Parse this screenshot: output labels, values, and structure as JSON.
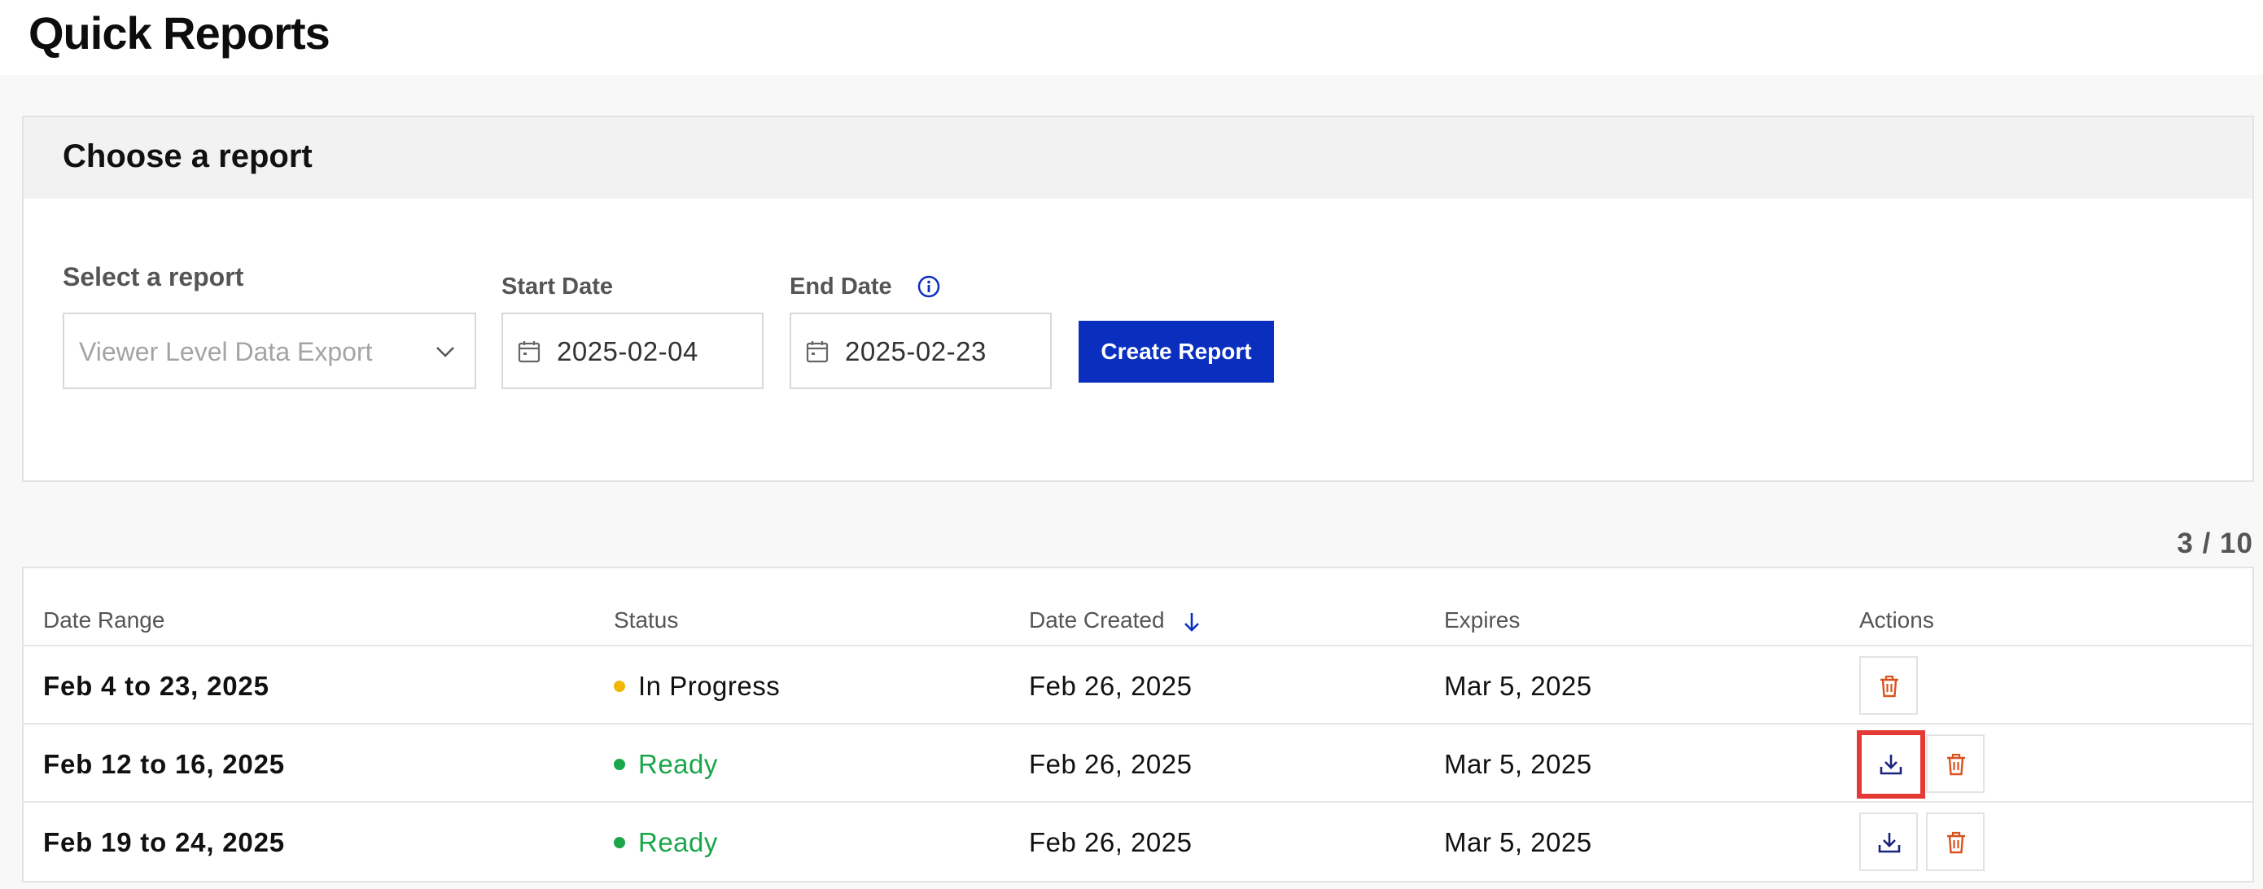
{
  "page": {
    "title": "Quick Reports"
  },
  "panel": {
    "title": "Choose a report",
    "select_label": "Select a report",
    "select_value": "Viewer Level Data Export",
    "start_label": "Start Date",
    "start_value": "2025-02-04",
    "end_label": "End Date",
    "end_value": "2025-02-23",
    "create_button": "Create Report"
  },
  "count": "3 / 10",
  "table": {
    "headers": {
      "date_range": "Date Range",
      "status": "Status",
      "date_created": "Date Created",
      "expires": "Expires",
      "actions": "Actions"
    },
    "rows": [
      {
        "range": "Feb 4 to 23, 2025",
        "status": "In Progress",
        "created": "Feb 26, 2025",
        "expires": "Mar 5, 2025",
        "actions": [
          "delete"
        ]
      },
      {
        "range": "Feb 12 to 16, 2025",
        "status": "Ready",
        "created": "Feb 26, 2025",
        "expires": "Mar 5, 2025",
        "actions": [
          "download",
          "delete"
        ]
      },
      {
        "range": "Feb 19 to 24, 2025",
        "status": "Ready",
        "created": "Feb 26, 2025",
        "expires": "Mar 5, 2025",
        "actions": [
          "download",
          "delete"
        ]
      }
    ]
  },
  "colors": {
    "primary": "#0a2fbf",
    "ready": "#1aa64a",
    "in_progress": "#f2b705",
    "delete": "#d9531e",
    "highlight": "#e53935"
  }
}
